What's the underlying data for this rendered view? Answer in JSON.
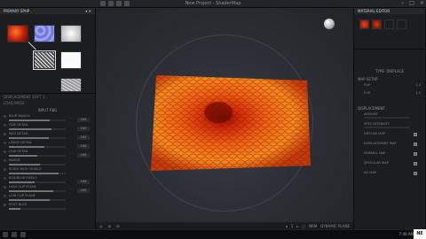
{
  "window": {
    "title": "New Project - ShaderMap"
  },
  "taskbar": {
    "clock": "7:40 AM",
    "texel": "TEXEL",
    "watermark": "NE"
  },
  "left_panel": {
    "header": "PRIMARY SPHP",
    "sub": "DISPLACEMENT SOFT 1",
    "sub2": "LOAD MASK",
    "section": "INPUT RBG",
    "rows": [
      {
        "label": "BLUR RADIUS",
        "value": "100",
        "fill": 0.72
      },
      {
        "label": "FINE DETAIL",
        "value": "100",
        "fill": 0.75
      },
      {
        "label": "MED DETAIL",
        "value": "100",
        "fill": 0.7
      },
      {
        "label": "LARGE DETAIL",
        "value": "100",
        "fill": 0.62
      },
      {
        "label": "LOW DETAIL",
        "value": "100",
        "fill": 0.5
      },
      {
        "label": "INVERT",
        "value": "",
        "fill": 0.55
      },
      {
        "label": "SCALE HIGH TEXELS",
        "value": "",
        "fill": 0.88
      },
      {
        "label": "BOX/BLUR PIXELS",
        "value": "100",
        "fill": 0.45
      },
      {
        "label": "HIGH CLIP PLANE",
        "value": "100",
        "fill": 0.78
      },
      {
        "label": "LOW CLIP PLANE",
        "value": "",
        "fill": 0.72
      },
      {
        "label": "POST BLUR",
        "value": "",
        "fill": 0.2
      }
    ]
  },
  "viewport": {
    "bottom_left": [
      "◎",
      "⊞",
      "☰"
    ],
    "bottom_right": [
      "◂",
      "1",
      "▸",
      "▢",
      "NRM",
      "DYNAMIC PLANE"
    ]
  },
  "right_panel": {
    "header": "MATERIAL EDITOR",
    "type_label": "TYPE: DISPLACE",
    "map_label": "MAP SETUP",
    "map_rows": [
      {
        "label": "FLIP",
        "value": "1.0"
      },
      {
        "label": "FLIP",
        "value": "1.0"
      }
    ],
    "section": "DISPLACEMENT",
    "rows": [
      {
        "label": "AMOUNT",
        "fill": 0.35
      },
      {
        "label": "SPEC INTENSITY",
        "fill": 0.6
      },
      {
        "label": "DIFFUSE MAP",
        "fill": 0
      },
      {
        "label": "DISPLACEMENT MAP",
        "fill": 0
      },
      {
        "label": "NORMAL MAP",
        "fill": 0
      },
      {
        "label": "SPECULAR MAP",
        "fill": 0
      },
      {
        "label": "AO MAP",
        "fill": 0
      }
    ]
  }
}
